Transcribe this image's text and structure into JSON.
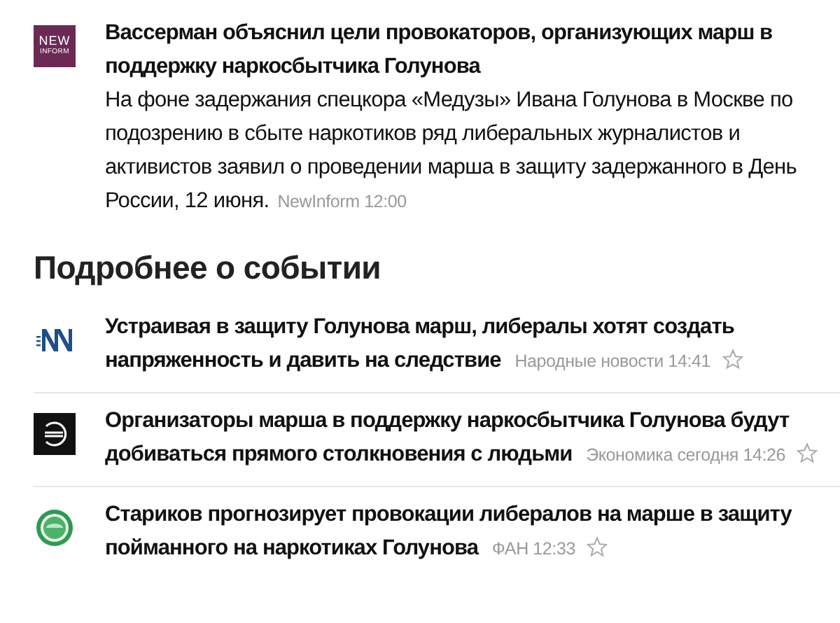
{
  "main_story": {
    "source_logo": {
      "lines": [
        "NEW",
        "INFORM"
      ]
    },
    "title": "Вассерман объяснил цели провокаторов, организующих марш в поддержку наркосбытчика Голунова",
    "summary": "На фоне задержания спецкора «Медузы» Ивана Голунова в Москве по подозрению в сбыте наркотиков ряд либеральных журналистов и активистов заявил о проведении марша в защиту задержанного в День России, 12 июня.",
    "meta": "NewInform 12:00"
  },
  "section_title": "Подробнее о событии",
  "related": [
    {
      "title": "Устраивая в защиту Голунова марш, либералы хотят создать напряженность и давить на следствие",
      "meta": "Народные новости 14:41",
      "favorite": false
    },
    {
      "title": "Организаторы марша в поддержку наркосбытчика Голунова будут добиваться прямого столкновения с людьми",
      "meta": "Экономика сегодня 14:26",
      "favorite": false
    },
    {
      "title": "Стариков прогнозирует провокации либералов на марше в защиту пойманного на наркотиках Голунова",
      "meta": "ФАН 12:33",
      "favorite": false
    }
  ]
}
